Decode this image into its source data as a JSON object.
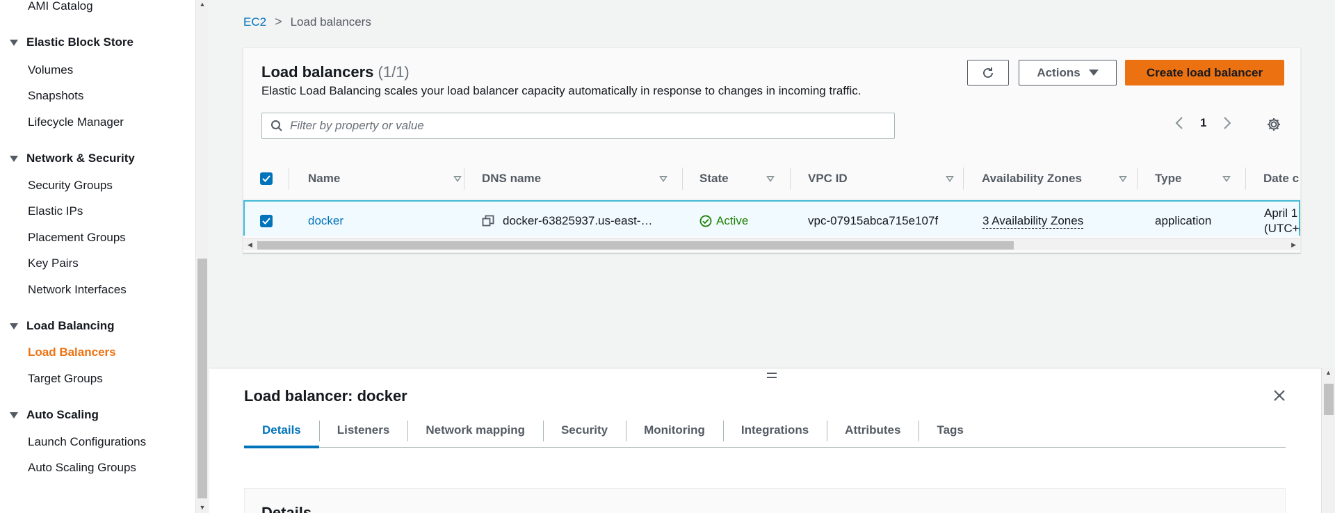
{
  "sidebar": {
    "top_item": "AMI Catalog",
    "sections": [
      {
        "title": "Elastic Block Store",
        "items": [
          "Volumes",
          "Snapshots",
          "Lifecycle Manager"
        ]
      },
      {
        "title": "Network & Security",
        "items": [
          "Security Groups",
          "Elastic IPs",
          "Placement Groups",
          "Key Pairs",
          "Network Interfaces"
        ]
      },
      {
        "title": "Load Balancing",
        "items": [
          "Load Balancers",
          "Target Groups"
        ]
      },
      {
        "title": "Auto Scaling",
        "items": [
          "Launch Configurations",
          "Auto Scaling Groups"
        ]
      }
    ],
    "active_item": "Load Balancers"
  },
  "breadcrumb": {
    "root": "EC2",
    "current": "Load balancers"
  },
  "panel": {
    "title": "Load balancers",
    "count": "(1/1)",
    "description": "Elastic Load Balancing scales your load balancer capacity automatically in response to changes in incoming traffic.",
    "actions_label": "Actions",
    "create_label": "Create load balancer",
    "filter_placeholder": "Filter by property or value",
    "page": "1"
  },
  "table": {
    "columns": [
      "Name",
      "DNS name",
      "State",
      "VPC ID",
      "Availability Zones",
      "Type",
      "Date c"
    ],
    "row": {
      "name": "docker",
      "dns": "docker-63825937.us-east-…",
      "state": "Active",
      "vpc": "vpc-07915abca715e107f",
      "zones": "3 Availability Zones",
      "type": "application",
      "date_line1": "April 1",
      "date_line2": "(UTC+("
    }
  },
  "split": {
    "title": "Load balancer: docker",
    "tabs": [
      "Details",
      "Listeners",
      "Network mapping",
      "Security",
      "Monitoring",
      "Integrations",
      "Attributes",
      "Tags"
    ],
    "active_tab": "Details",
    "section_heading": "Details"
  },
  "colors": {
    "accent": "#ec7211",
    "link": "#0073bb",
    "success": "#1d8102"
  }
}
